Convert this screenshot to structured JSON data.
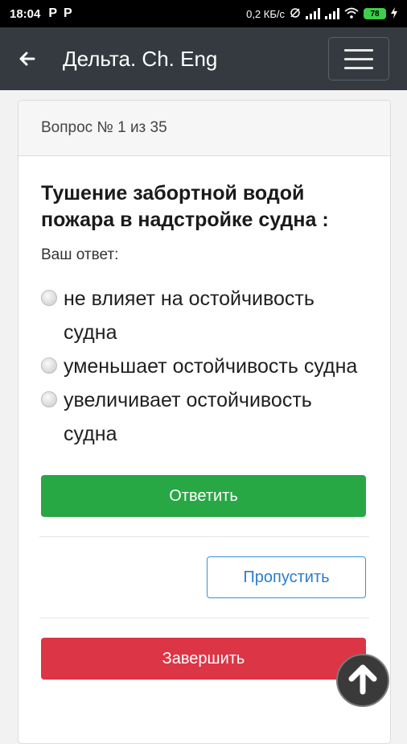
{
  "status_bar": {
    "time": "18:04",
    "notification_icons": [
      "P",
      "P"
    ],
    "network_speed": "0,2 КБ/с",
    "battery": "78"
  },
  "app_bar": {
    "title": "Дельта. Ch. Eng",
    "back_icon": "arrow-left-icon",
    "menu_icon": "hamburger-icon"
  },
  "quiz": {
    "header": "Вопрос № 1 из 35",
    "question": "Тушение забортной водой пожара в надстройке судна :",
    "answer_label": "Ваш ответ:",
    "options": [
      {
        "text": "не влияет на остойчивость судна"
      },
      {
        "text": "уменьшает остойчивость судна"
      },
      {
        "text": "увеличивает остойчивость судна"
      }
    ],
    "answer_button": "Ответить",
    "skip_button": "Пропустить",
    "finish_button": "Завершить"
  },
  "colors": {
    "app_bar": "#343a40",
    "answer": "#28a745",
    "skip": "#2b7bd0",
    "finish": "#dc3545"
  }
}
